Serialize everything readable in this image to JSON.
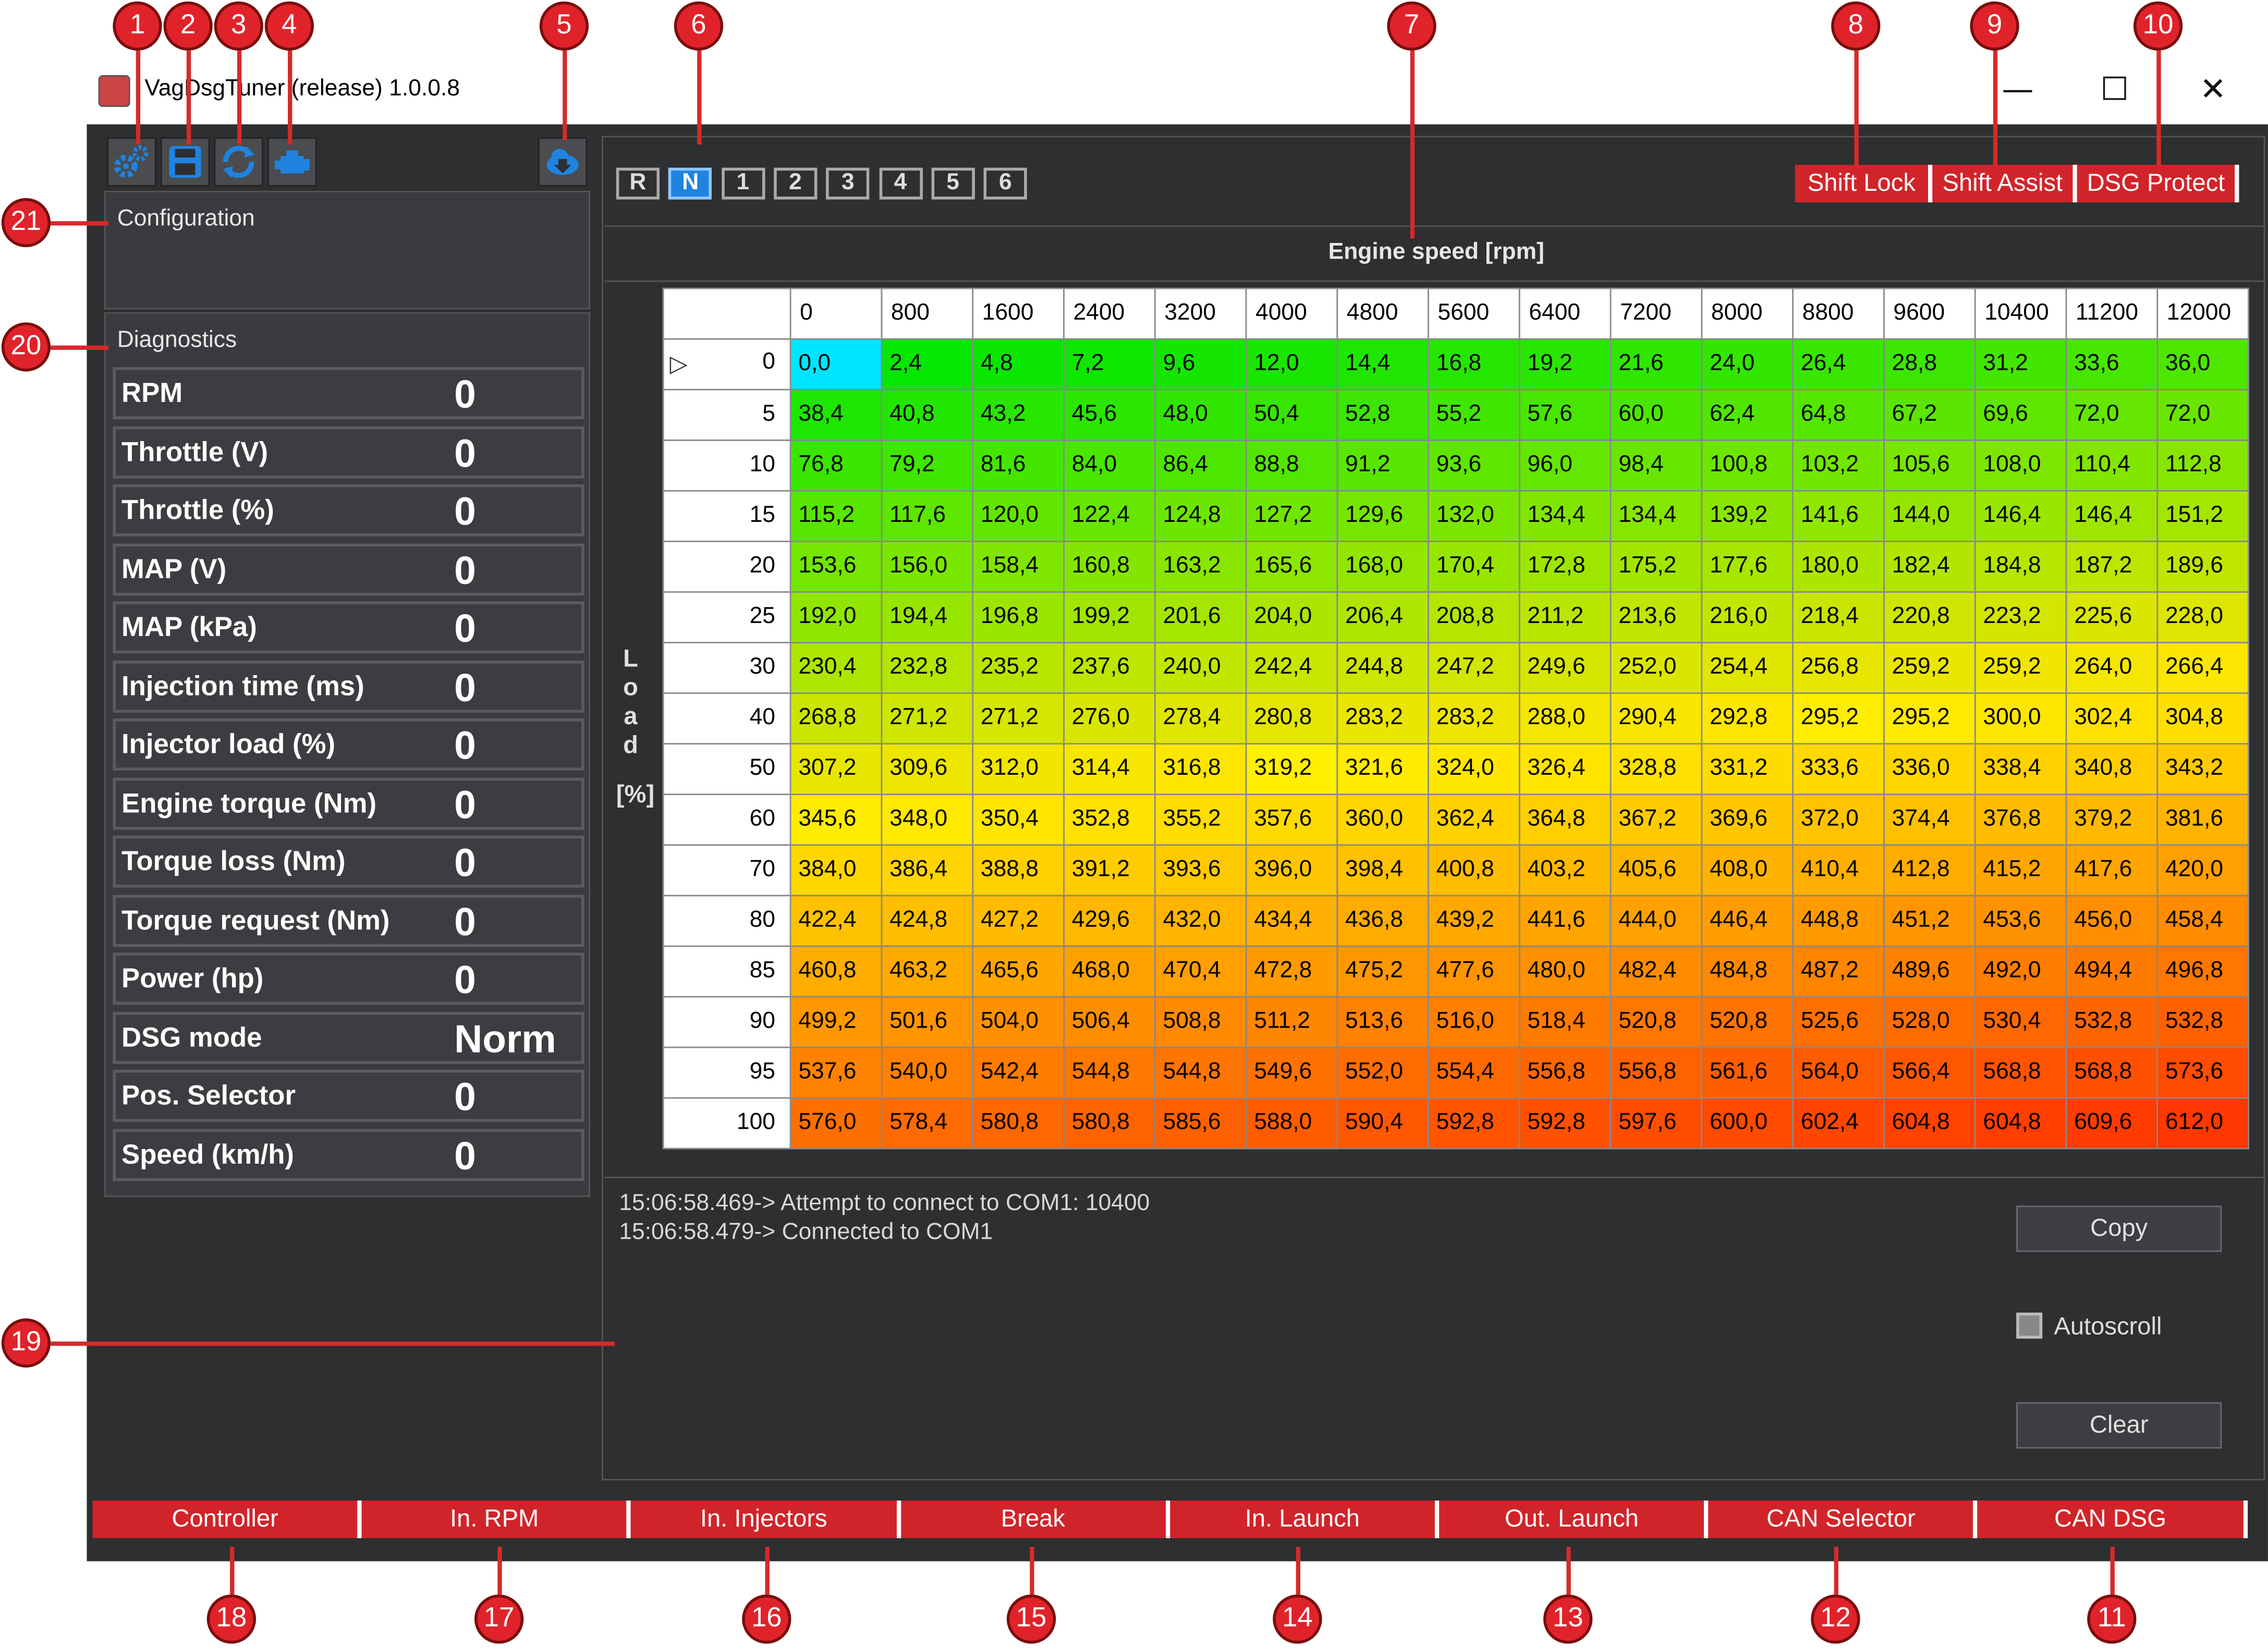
{
  "window": {
    "title": "VagDsgTuner (release) 1.0.0.8",
    "controls": {
      "minimize": "—",
      "maximize": "☐",
      "close": "✕"
    }
  },
  "toolbar": {
    "icons": [
      "gear-settings-icon",
      "save-icon",
      "refresh-icon",
      "engine-icon",
      "cloud-download-icon"
    ]
  },
  "configuration": {
    "title": "Configuration"
  },
  "diagnostics": {
    "title": "Diagnostics",
    "rows": [
      {
        "label": "RPM",
        "value": "0"
      },
      {
        "label": "Throttle (V)",
        "value": "0"
      },
      {
        "label": "Throttle (%)",
        "value": "0"
      },
      {
        "label": "MAP (V)",
        "value": "0"
      },
      {
        "label": "MAP (kPa)",
        "value": "0"
      },
      {
        "label": "Injection time (ms)",
        "value": "0"
      },
      {
        "label": "Injector load (%)",
        "value": "0"
      },
      {
        "label": "Engine torque (Nm)",
        "value": "0"
      },
      {
        "label": "Torque loss (Nm)",
        "value": "0"
      },
      {
        "label": "Torque request (Nm)",
        "value": "0"
      },
      {
        "label": "Power (hp)",
        "value": "0"
      },
      {
        "label": "DSG mode",
        "value": "Norm"
      },
      {
        "label": "Pos. Selector",
        "value": "0"
      },
      {
        "label": "Speed (km/h)",
        "value": "0"
      }
    ]
  },
  "gears": {
    "items": [
      "R",
      "N",
      "1",
      "2",
      "3",
      "4",
      "5",
      "6"
    ],
    "active": "N"
  },
  "protect_buttons": [
    "Shift Lock",
    "Shift Assist",
    "DSG Protect"
  ],
  "map": {
    "x_label": "Engine speed [rpm]",
    "y_label_letters": [
      "L",
      "o",
      "a",
      "d"
    ],
    "y_label_unit": "[%]",
    "row_marker": "▷",
    "rpm": [
      "0",
      "800",
      "1600",
      "2400",
      "3200",
      "4000",
      "4800",
      "5600",
      "6400",
      "7200",
      "8000",
      "8800",
      "9600",
      "10400",
      "11200",
      "12000"
    ],
    "load": [
      "0",
      "5",
      "10",
      "15",
      "20",
      "25",
      "30",
      "40",
      "50",
      "60",
      "70",
      "80",
      "85",
      "90",
      "95",
      "100"
    ],
    "cells": [
      [
        "0,0",
        "2,4",
        "4,8",
        "7,2",
        "9,6",
        "12,0",
        "14,4",
        "16,8",
        "19,2",
        "21,6",
        "24,0",
        "26,4",
        "28,8",
        "31,2",
        "33,6",
        "36,0"
      ],
      [
        "38,4",
        "40,8",
        "43,2",
        "45,6",
        "48,0",
        "50,4",
        "52,8",
        "55,2",
        "57,6",
        "60,0",
        "62,4",
        "64,8",
        "67,2",
        "69,6",
        "72,0",
        "72,0"
      ],
      [
        "76,8",
        "79,2",
        "81,6",
        "84,0",
        "86,4",
        "88,8",
        "91,2",
        "93,6",
        "96,0",
        "98,4",
        "100,8",
        "103,2",
        "105,6",
        "108,0",
        "110,4",
        "112,8"
      ],
      [
        "115,2",
        "117,6",
        "120,0",
        "122,4",
        "124,8",
        "127,2",
        "129,6",
        "132,0",
        "134,4",
        "134,4",
        "139,2",
        "141,6",
        "144,0",
        "146,4",
        "146,4",
        "151,2"
      ],
      [
        "153,6",
        "156,0",
        "158,4",
        "160,8",
        "163,2",
        "165,6",
        "168,0",
        "170,4",
        "172,8",
        "175,2",
        "177,6",
        "180,0",
        "182,4",
        "184,8",
        "187,2",
        "189,6"
      ],
      [
        "192,0",
        "194,4",
        "196,8",
        "199,2",
        "201,6",
        "204,0",
        "206,4",
        "208,8",
        "211,2",
        "213,6",
        "216,0",
        "218,4",
        "220,8",
        "223,2",
        "225,6",
        "228,0"
      ],
      [
        "230,4",
        "232,8",
        "235,2",
        "237,6",
        "240,0",
        "242,4",
        "244,8",
        "247,2",
        "249,6",
        "252,0",
        "254,4",
        "256,8",
        "259,2",
        "259,2",
        "264,0",
        "266,4"
      ],
      [
        "268,8",
        "271,2",
        "271,2",
        "276,0",
        "278,4",
        "280,8",
        "283,2",
        "283,2",
        "288,0",
        "290,4",
        "292,8",
        "295,2",
        "295,2",
        "300,0",
        "302,4",
        "304,8"
      ],
      [
        "307,2",
        "309,6",
        "312,0",
        "314,4",
        "316,8",
        "319,2",
        "321,6",
        "324,0",
        "326,4",
        "328,8",
        "331,2",
        "333,6",
        "336,0",
        "338,4",
        "340,8",
        "343,2"
      ],
      [
        "345,6",
        "348,0",
        "350,4",
        "352,8",
        "355,2",
        "357,6",
        "360,0",
        "362,4",
        "364,8",
        "367,2",
        "369,6",
        "372,0",
        "374,4",
        "376,8",
        "379,2",
        "381,6"
      ],
      [
        "384,0",
        "386,4",
        "388,8",
        "391,2",
        "393,6",
        "396,0",
        "398,4",
        "400,8",
        "403,2",
        "405,6",
        "408,0",
        "410,4",
        "412,8",
        "415,2",
        "417,6",
        "420,0"
      ],
      [
        "422,4",
        "424,8",
        "427,2",
        "429,6",
        "432,0",
        "434,4",
        "436,8",
        "439,2",
        "441,6",
        "444,0",
        "446,4",
        "448,8",
        "451,2",
        "453,6",
        "456,0",
        "458,4"
      ],
      [
        "460,8",
        "463,2",
        "465,6",
        "468,0",
        "470,4",
        "472,8",
        "475,2",
        "477,6",
        "480,0",
        "482,4",
        "484,8",
        "487,2",
        "489,6",
        "492,0",
        "494,4",
        "496,8"
      ],
      [
        "499,2",
        "501,6",
        "504,0",
        "506,4",
        "508,8",
        "511,2",
        "513,6",
        "516,0",
        "518,4",
        "520,8",
        "520,8",
        "525,6",
        "528,0",
        "530,4",
        "532,8",
        "532,8"
      ],
      [
        "537,6",
        "540,0",
        "542,4",
        "544,8",
        "544,8",
        "549,6",
        "552,0",
        "554,4",
        "556,8",
        "556,8",
        "561,6",
        "564,0",
        "566,4",
        "568,8",
        "568,8",
        "573,6"
      ],
      [
        "576,0",
        "578,4",
        "580,8",
        "580,8",
        "585,6",
        "588,0",
        "590,4",
        "592,8",
        "592,8",
        "597,6",
        "600,0",
        "602,4",
        "604,8",
        "604,8",
        "609,6",
        "612,0"
      ]
    ],
    "selected_cell_color": "#00e5ff"
  },
  "log": {
    "lines": [
      "15:06:58.469-> Attempt to connect to COM1: 10400",
      "15:06:58.479-> Connected to COM1"
    ],
    "copy_label": "Copy",
    "autoscroll_label": "Autoscroll",
    "clear_label": "Clear"
  },
  "bottom_tabs": [
    "Controller",
    "In. RPM",
    "In. Injectors",
    "Break",
    "In. Launch",
    "Out. Launch",
    "CAN Selector",
    "CAN DSG"
  ],
  "annotations": [
    "1",
    "2",
    "3",
    "4",
    "5",
    "6",
    "7",
    "8",
    "9",
    "10",
    "11",
    "12",
    "13",
    "14",
    "15",
    "16",
    "17",
    "18",
    "19",
    "20",
    "21"
  ],
  "colors": {
    "accent_red": "#d0242a",
    "badge_red": "#e0232a",
    "window_bg": "#2d2f31"
  }
}
